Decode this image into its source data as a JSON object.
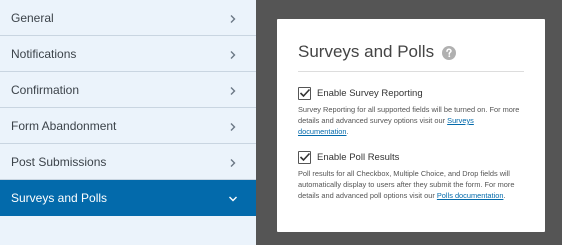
{
  "sidebar": {
    "items": [
      {
        "label": "General"
      },
      {
        "label": "Notifications"
      },
      {
        "label": "Confirmation"
      },
      {
        "label": "Form Abandonment"
      },
      {
        "label": "Post Submissions"
      },
      {
        "label": "Surveys and Polls",
        "active": true
      }
    ]
  },
  "panel": {
    "title": "Surveys and Polls",
    "survey": {
      "label": "Enable Survey Reporting",
      "checked": true,
      "desc_before": "Survey Reporting for all supported fields will be turned on. For more details and advanced survey options visit our ",
      "link": "Surveys documentation",
      "desc_after": "."
    },
    "poll": {
      "label": "Enable Poll Results",
      "checked": true,
      "desc_before": "Poll results for all Checkbox, Multiple Choice, and Drop fields will automatically display to users after they submit the form. For more details and advanced poll options visit our ",
      "link": "Polls documentation",
      "desc_after": "."
    }
  },
  "colors": {
    "active_bg": "#036aab",
    "sidebar_bg": "#ebf3fb",
    "backdrop": "#555555",
    "link": "#036aab"
  },
  "icons": {
    "chevron_right": "chevron-right-icon",
    "chevron_down": "chevron-down-icon",
    "help": "help-icon",
    "check": "check-icon"
  }
}
